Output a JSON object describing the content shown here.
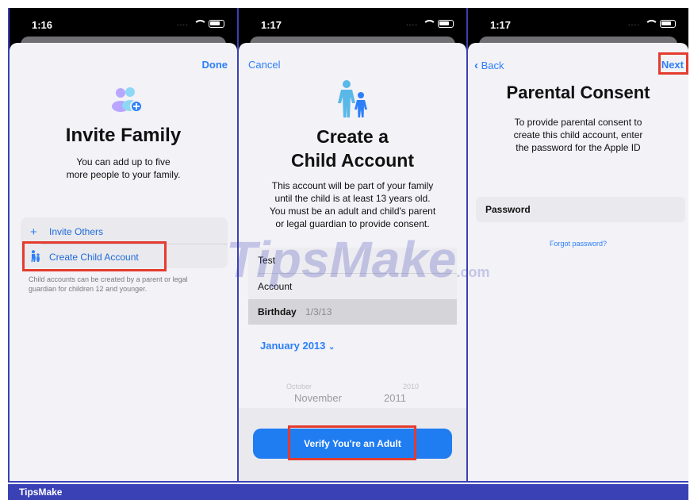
{
  "status_bar": [
    {
      "time": "1:16"
    },
    {
      "time": "1:17"
    },
    {
      "time": "1:17"
    }
  ],
  "panel1": {
    "nav_right": "Done",
    "title": "Invite Family",
    "description": [
      "You can add up to five",
      "more people to your family."
    ],
    "items": [
      {
        "icon": "plus-icon",
        "label": "Invite Others"
      },
      {
        "icon": "child-icon",
        "label": "Create Child Account"
      }
    ],
    "footnote": [
      "Child accounts can be created by a parent or legal",
      "guardian for children 12 and younger."
    ]
  },
  "panel2": {
    "nav_left": "Cancel",
    "title": [
      "Create a",
      "Child Account"
    ],
    "description": [
      "This account will be part of your family",
      "until the child is at least 13 years old.",
      "You must be an adult and child's parent",
      "or legal guardian to provide consent."
    ],
    "first_name": "Test",
    "last_name": "Account",
    "birthday_label": "Birthday",
    "birthday_value": "1/3/13",
    "month_picker": "January 2013",
    "wheel": {
      "prev_month": "October",
      "prev_year": "2010",
      "month": "November",
      "year": "2011"
    },
    "verify_button": "Verify You're an Adult"
  },
  "panel3": {
    "nav_left": "Back",
    "nav_right": "Next",
    "title": "Parental Consent",
    "description": [
      "To provide parental consent to",
      "create this child account, enter",
      "the password for the Apple ID"
    ],
    "password_label": "Password",
    "forgot": "Forgot password?"
  },
  "watermark": {
    "main": "TipsMake",
    "suffix": ".com"
  },
  "footer": "TipsMake",
  "colors": {
    "accent": "#2d7ff9",
    "highlight": "#e53b2f",
    "frame": "#3a41b5"
  }
}
